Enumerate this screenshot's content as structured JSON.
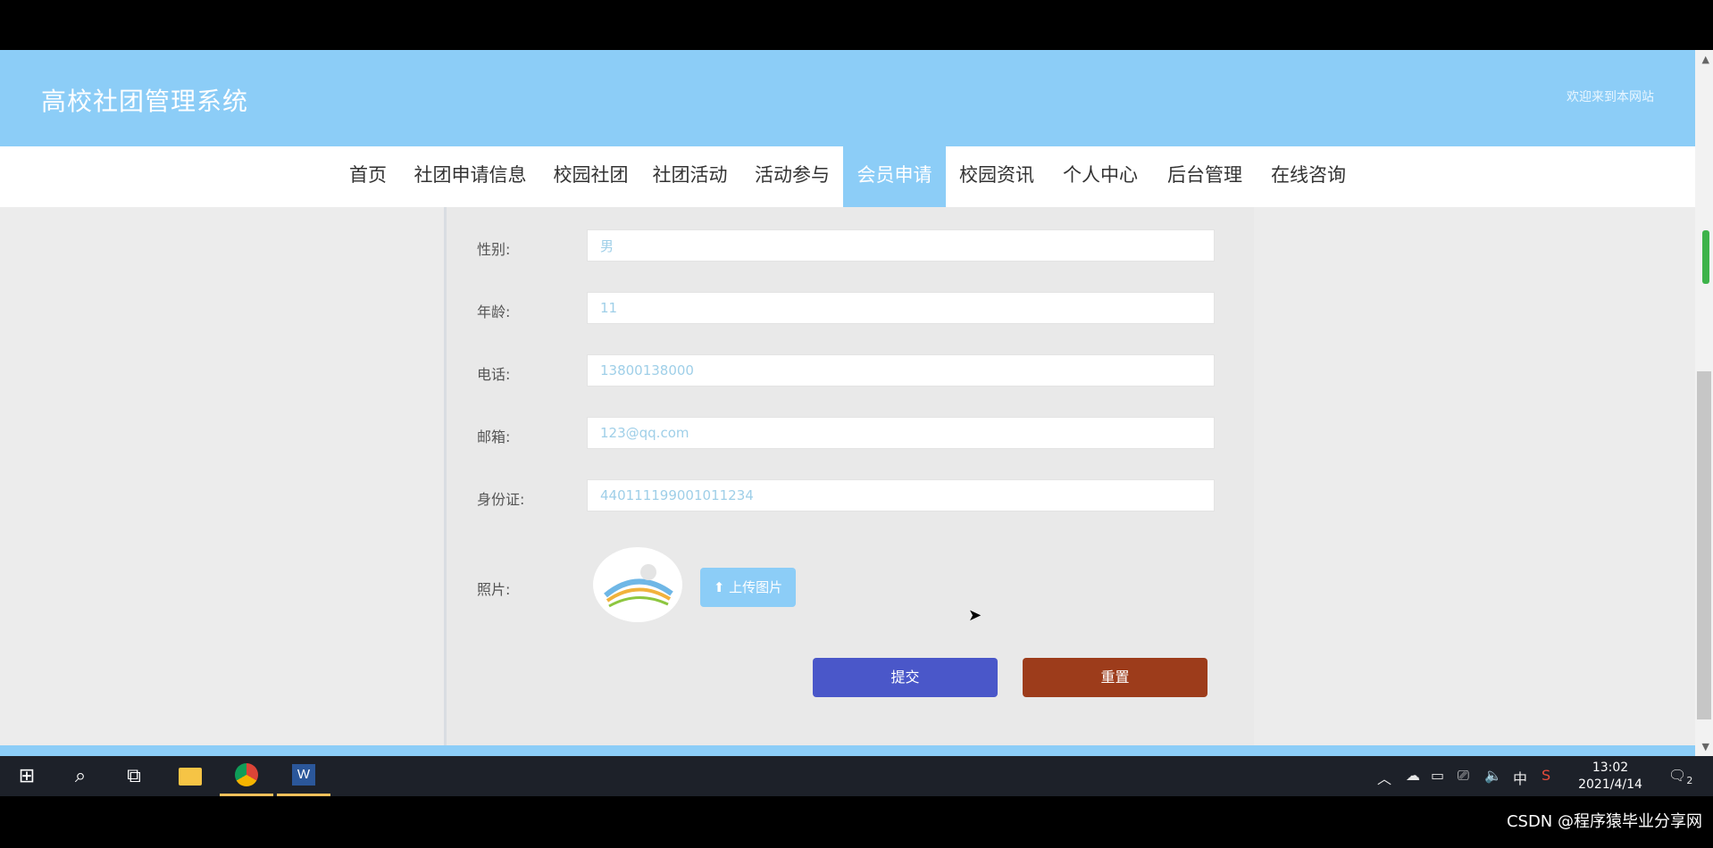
{
  "site": {
    "title": "高校社团管理系统",
    "welcome_text": "欢迎来到本网站"
  },
  "nav": {
    "items": [
      {
        "label": "首页"
      },
      {
        "label": "社团申请信息"
      },
      {
        "label": "校园社团"
      },
      {
        "label": "社团活动"
      },
      {
        "label": "活动参与"
      },
      {
        "label": "会员申请",
        "active": true
      },
      {
        "label": "校园资讯"
      },
      {
        "label": "个人中心"
      },
      {
        "label": "后台管理"
      },
      {
        "label": "在线咨询"
      }
    ]
  },
  "form": {
    "gender": {
      "label": "性别:",
      "value": "男"
    },
    "age": {
      "label": "年龄:",
      "value": "11"
    },
    "phone": {
      "label": "电话:",
      "value": "13800138000"
    },
    "email": {
      "label": "邮箱:",
      "value": "123@qq.com"
    },
    "id_card": {
      "label": "身份证:",
      "value": "440111199001011234"
    },
    "photo": {
      "label": "照片:",
      "upload_label": "上传图片"
    },
    "submit_label": "提交",
    "reset_label": "重置"
  },
  "taskbar": {
    "time": "13:02",
    "date": "2021/4/14",
    "ime": "中",
    "notification_count": "2"
  },
  "watermark": "CSDN @程序猿毕业分享网",
  "colors": {
    "header": "#8ccdf7",
    "submit": "#4a57c9",
    "reset": "#9d3c1b"
  }
}
